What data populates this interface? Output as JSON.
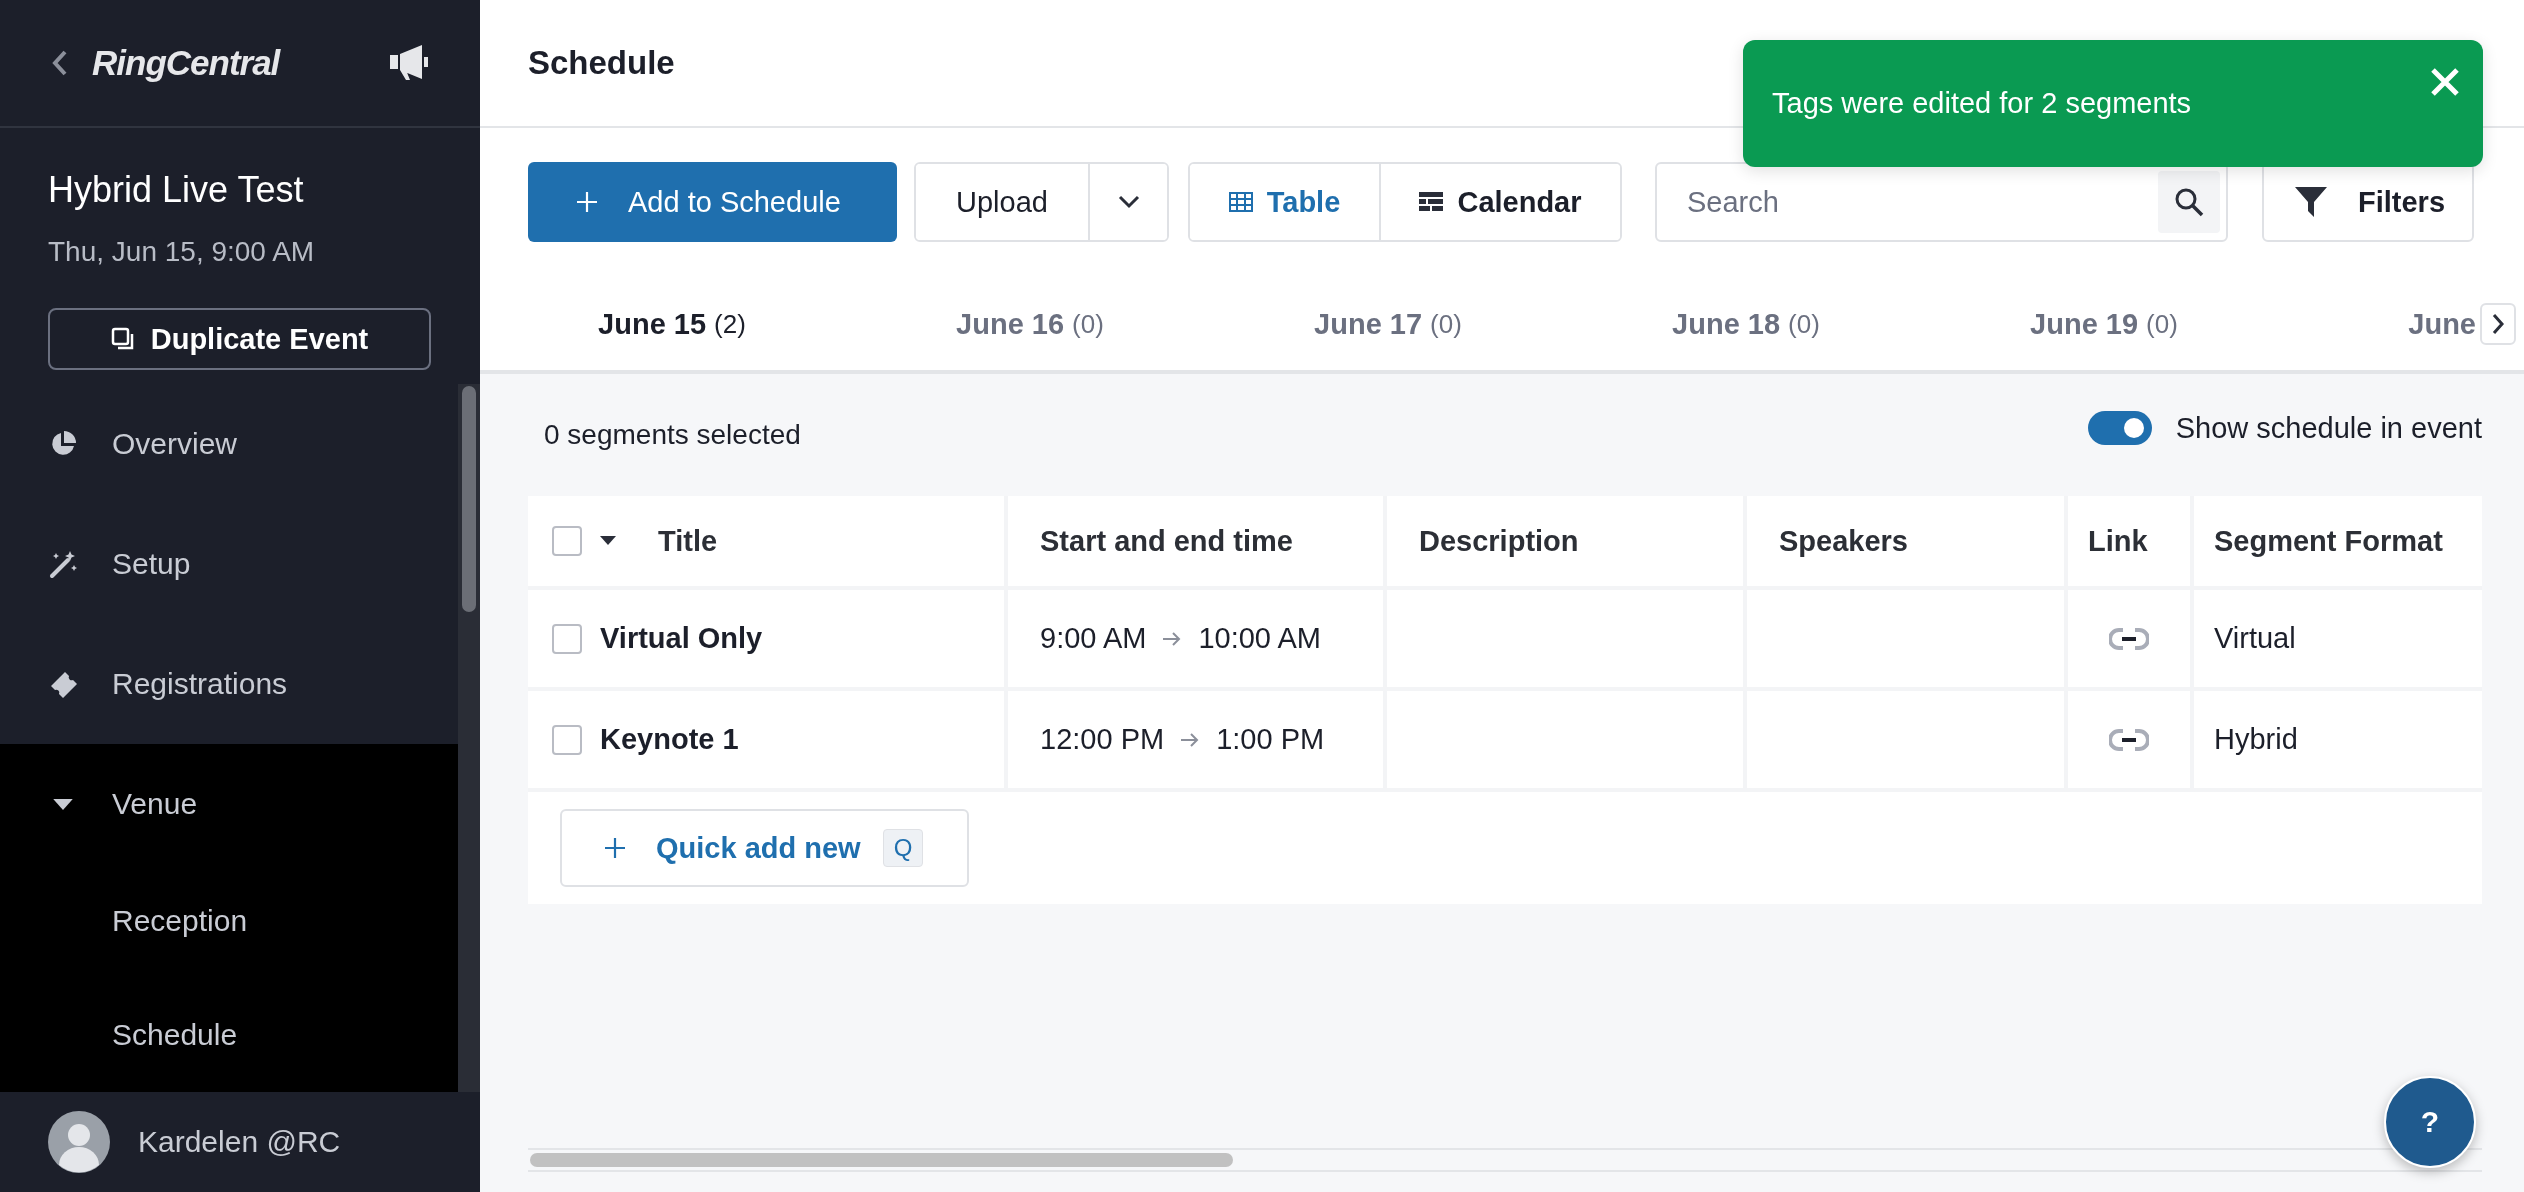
{
  "sidebar": {
    "logo": "RingCentral",
    "event_title": "Hybrid Live Test",
    "event_date": "Thu, Jun 15, 9:00 AM",
    "duplicate_button": "Duplicate Event",
    "nav": [
      {
        "label": "Overview",
        "kind": "overview"
      },
      {
        "label": "Setup",
        "kind": "setup"
      },
      {
        "label": "Registrations",
        "kind": "registrations"
      },
      {
        "label": "Venue",
        "kind": "group",
        "expanded": true,
        "children": [
          {
            "label": "Reception"
          },
          {
            "label": "Schedule"
          }
        ]
      }
    ],
    "user": {
      "name": "Kardelen @RC"
    }
  },
  "header": {
    "title": "Schedule"
  },
  "toolbar": {
    "add_button": "Add to Schedule",
    "upload_button": "Upload",
    "views": [
      {
        "label": "Table",
        "kind": "table",
        "selected": true
      },
      {
        "label": "Calendar",
        "kind": "calendar",
        "selected": false
      }
    ],
    "search": {
      "placeholder": "Search"
    },
    "filters_button": "Filters"
  },
  "toast": {
    "message": "Tags were edited for 2 segments"
  },
  "date_tabs": [
    {
      "label": "June 15",
      "count": "(2)",
      "selected": true
    },
    {
      "label": "June 16",
      "count": "(0)",
      "selected": false
    },
    {
      "label": "June 17",
      "count": "(0)",
      "selected": false
    },
    {
      "label": "June 18",
      "count": "(0)",
      "selected": false
    },
    {
      "label": "June 19",
      "count": "(0)",
      "selected": false
    },
    {
      "label": "June",
      "selected": false
    }
  ],
  "selection_summary": "0 segments selected",
  "show_schedule_toggle": {
    "label": "Show schedule in event",
    "on": true
  },
  "table": {
    "columns": [
      "Title",
      "Start and end time",
      "Description",
      "Speakers",
      "Link",
      "Segment Format"
    ],
    "select_all_checked": false,
    "rows": [
      {
        "title": "Virtual Only",
        "checked": false,
        "start": "9:00 AM",
        "end": "10:00 AM",
        "format": "Virtual"
      },
      {
        "title": "Keynote 1",
        "checked": false,
        "start": "12:00 PM",
        "end": "1:00 PM",
        "format": "Hybrid"
      }
    ]
  },
  "quick_add": {
    "label": "Quick add new",
    "shortcut": "Q"
  },
  "help_button": "?"
}
